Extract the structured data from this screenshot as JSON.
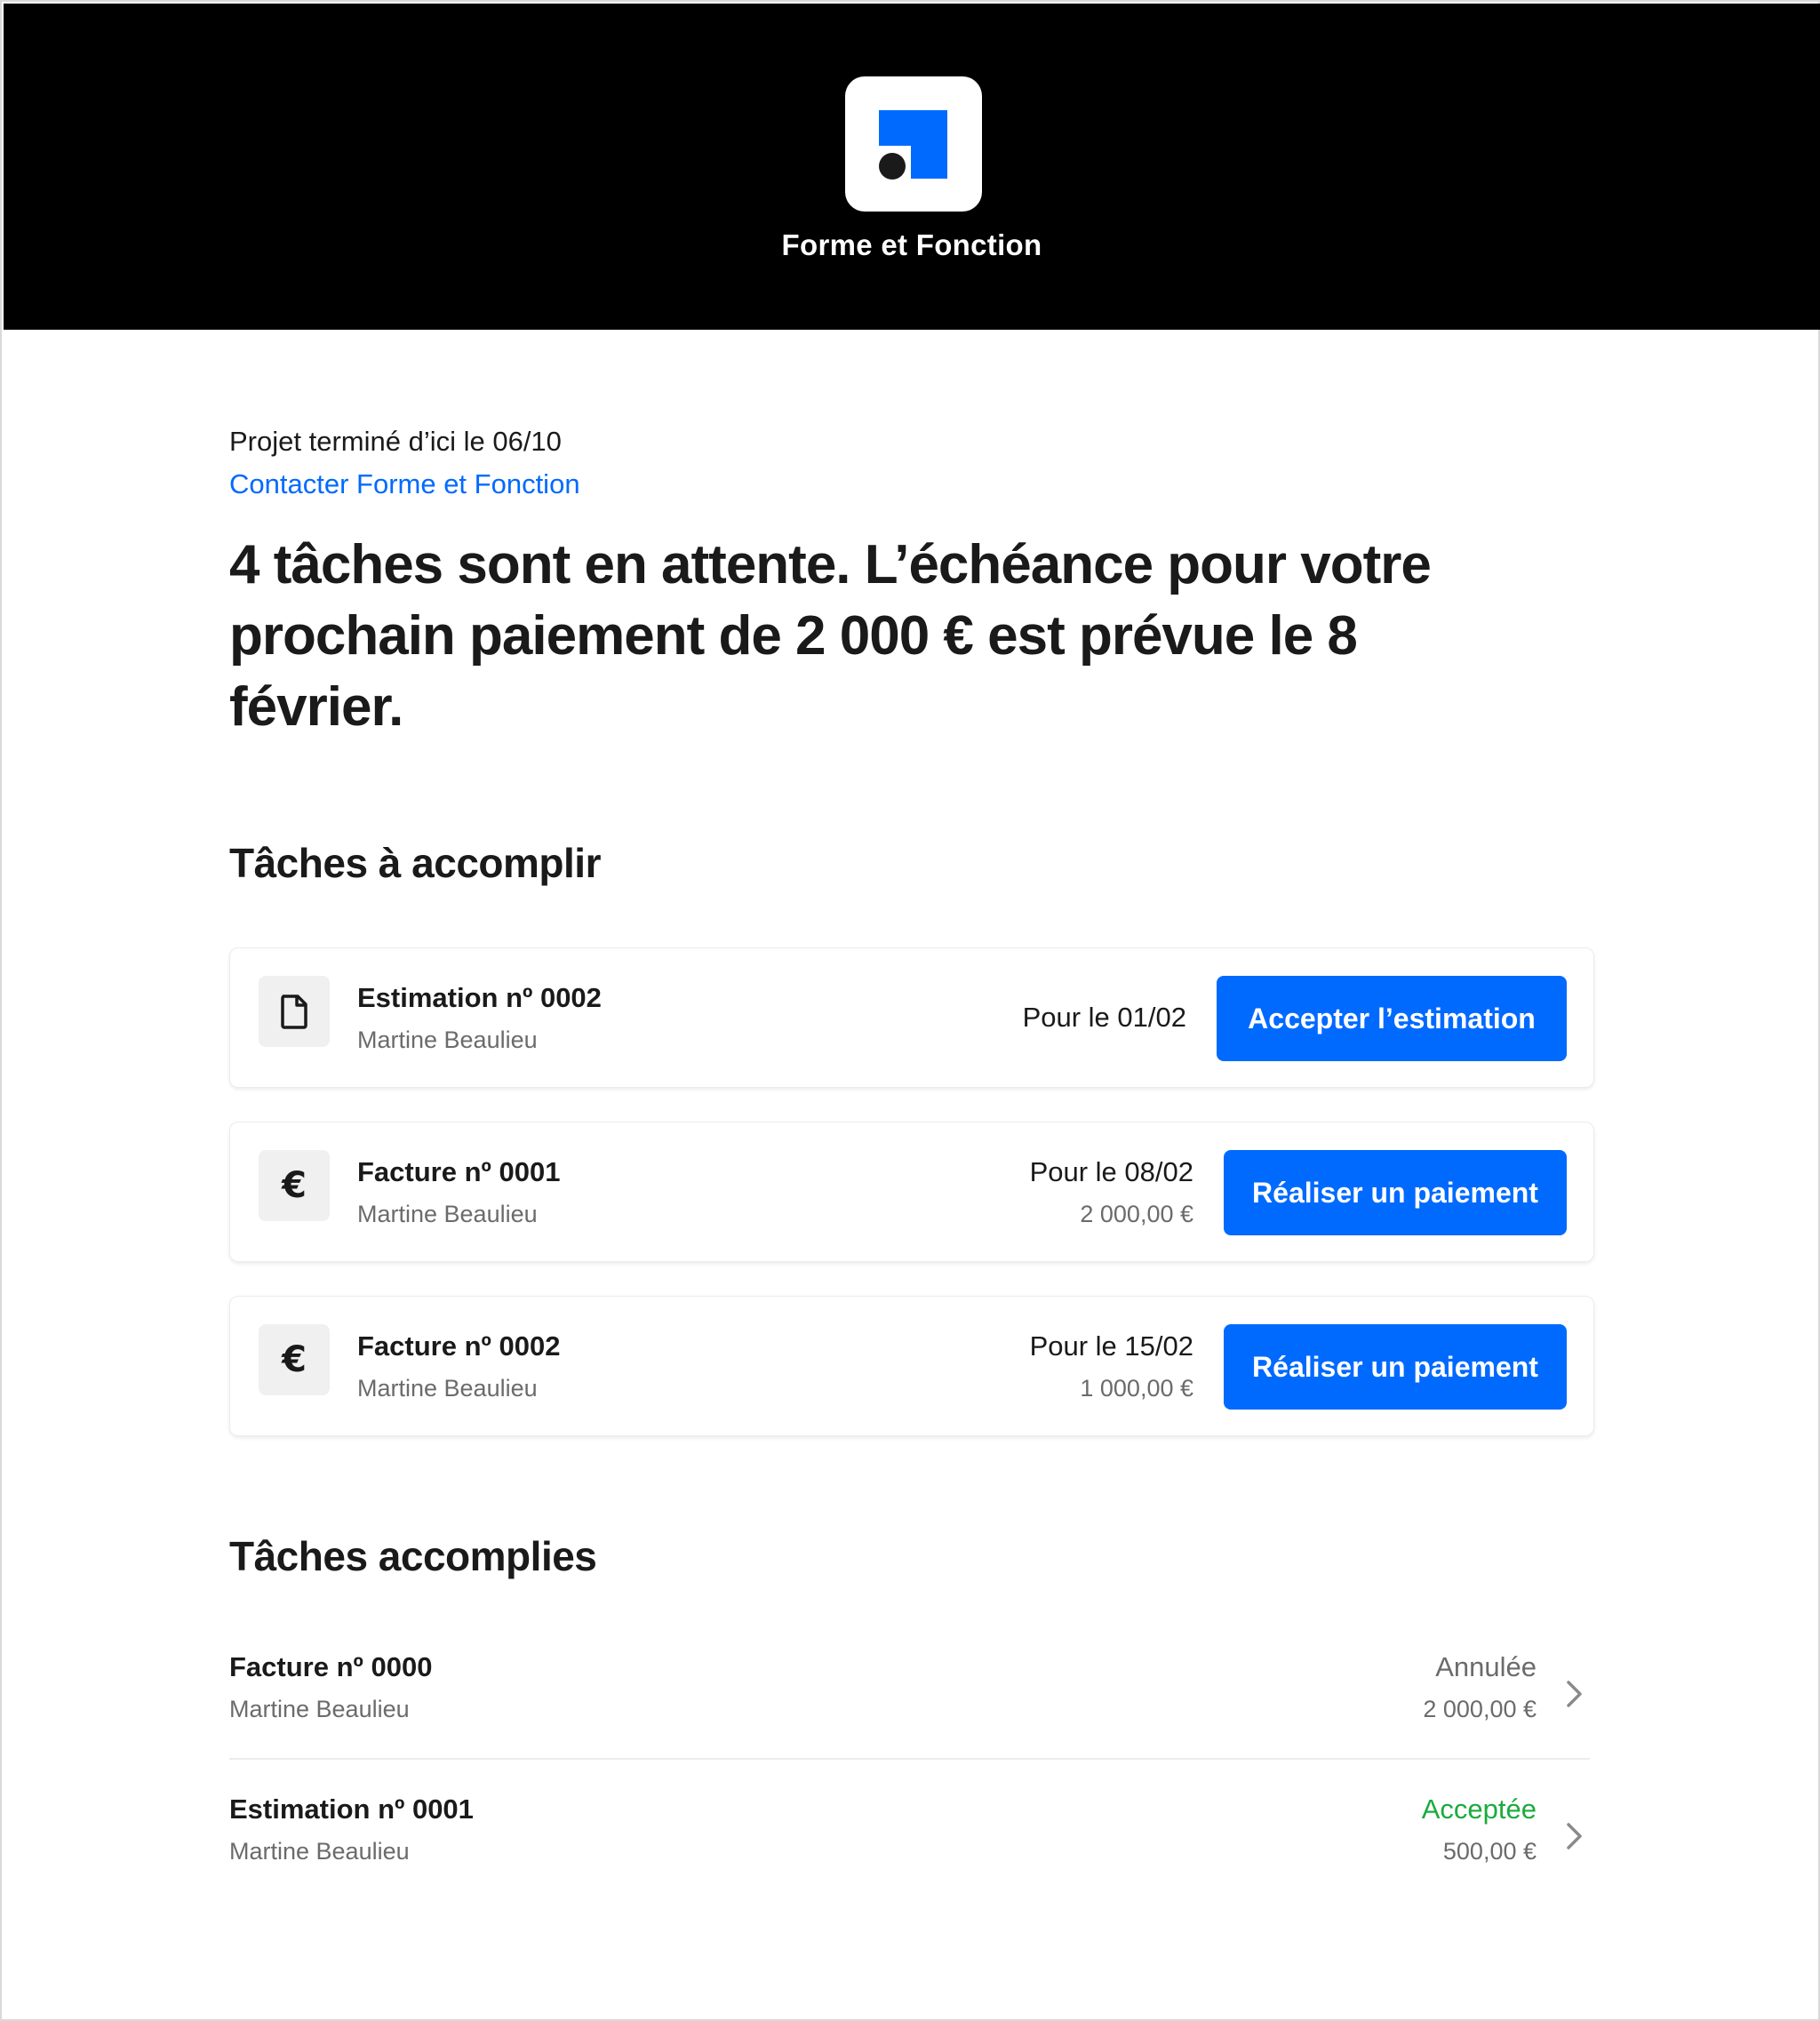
{
  "brand": {
    "name": "Forme et Fonction",
    "logo_colors": {
      "square": "#006aff",
      "dot": "#1a1a1a"
    }
  },
  "project": {
    "subtitle": "Projet terminé d’ici le 06/10",
    "contact_link": "Contacter Forme et Fonction",
    "headline": "4 tâches sont en attente. L’échéance pour votre prochain paiement de 2 000 € est prévue le 8 février."
  },
  "pending": {
    "title": "Tâches à accomplir",
    "tasks": [
      {
        "icon": "document-icon",
        "name": "Estimation nº 0002",
        "client": "Martine Beaulieu",
        "due": "Pour le 01/02",
        "amount": "",
        "button": "Accepter l’estimation"
      },
      {
        "icon": "euro-icon",
        "icon_glyph": "€",
        "name": "Facture nº 0001",
        "client": "Martine Beaulieu",
        "due": "Pour le 08/02",
        "amount": "2 000,00 €",
        "button": "Réaliser un paiement"
      },
      {
        "icon": "euro-icon",
        "icon_glyph": "€",
        "name": "Facture nº 0002",
        "client": "Martine Beaulieu",
        "due": "Pour le 15/02",
        "amount": "1 000,00 €",
        "button": "Réaliser un paiement"
      }
    ]
  },
  "completed": {
    "title": "Tâches accomplies",
    "items": [
      {
        "name": "Facture nº 0000",
        "client": "Martine Beaulieu",
        "status": "Annulée",
        "status_color": "#6b6b6b",
        "amount": "2 000,00 €",
        "icon": "chevron-right-icon"
      },
      {
        "name": "Estimation nº 0001",
        "client": "Martine Beaulieu",
        "status": "Acceptée",
        "status_color": "#1aab3d",
        "amount": "500,00 €",
        "icon": "chevron-right-icon"
      }
    ]
  },
  "colors": {
    "accent": "#006aff",
    "header_bg": "#000000",
    "muted_text": "#6b6b6b"
  }
}
